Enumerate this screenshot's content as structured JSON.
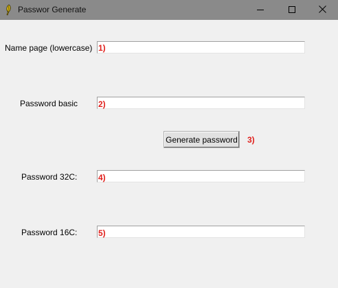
{
  "window": {
    "title": "Passwor Generate",
    "icon": "feather-icon",
    "controls": {
      "minimize": "minimize-icon",
      "maximize": "maximize-icon",
      "close": "close-icon"
    }
  },
  "form": {
    "name_page": {
      "label": "Name page (lowercase)",
      "value": "",
      "annotation": "1)"
    },
    "password_basic": {
      "label": "Password basic",
      "value": "",
      "annotation": "2)"
    },
    "generate_button": {
      "label": "Generate password",
      "annotation": "3)"
    },
    "password_32c": {
      "label": "Password 32C:",
      "value": "",
      "annotation": "4)"
    },
    "password_16c": {
      "label": "Password 16C:",
      "value": "",
      "annotation": "5)"
    }
  },
  "colors": {
    "titlebar": "#8a8a8a",
    "background": "#f0f0f0",
    "annotation": "#e0201c"
  }
}
